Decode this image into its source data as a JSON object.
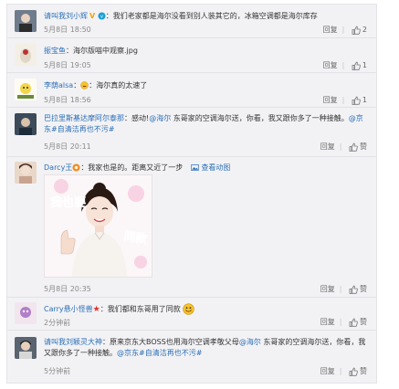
{
  "comments": [
    {
      "name": "请叫我刘小辉",
      "badge": "V",
      "text": "：我们老家都是海尔没看到别人装其它的，冰箱空调都是海尔库存",
      "date": "5月8日 18:50",
      "reply": "回复",
      "likes": "2"
    },
    {
      "name": "振宝鱼",
      "text": "：海尔版喵中观察.jpg",
      "date": "5月8日 19:05",
      "reply": "回复",
      "likes": "1"
    },
    {
      "name": "李荫alsa",
      "text": "：海尔真的太速了",
      "date": "5月8日 18:56",
      "reply": "回复",
      "likes": "1"
    },
    {
      "name": "巴拉里斯基达摩阿尔泰那",
      "text_a": "：感动!",
      "mention_a": "@海尔",
      "text_b": " 东哥家的空调海尔送，你看，我又跟你多了一种接触。",
      "mention_b": "@京东",
      "hashtag": "#自清洁再也不污#",
      "date": "5月8日 20:11",
      "reply": "回复",
      "likes": "赞"
    },
    {
      "name": "Darcy王",
      "text": "：我家也是的。距离又近了一步",
      "view_pic": "查看动图",
      "date": "5月8日 20:35",
      "reply": "回复",
      "likes": "赞"
    },
    {
      "name": "Carry悬小怪兽",
      "text": "：我们都和东哥用了同款",
      "date": "2分钟前",
      "reply": "回复",
      "likes": "赞"
    },
    {
      "name": "请叫我刘颖灵大神",
      "text_a": "：原来京东大BOSS也用海尔空调孝敬父母",
      "mention_a": "@海尔",
      "text_b": " 东哥家的空调海尔送，你看，我又跟你多了一种接触。",
      "mention_b": "@京东",
      "hashtag": "#自清洁再也不污#",
      "date": "5分钟前",
      "reply": "回复",
      "likes": "赞"
    }
  ],
  "image_text": {
    "left": "我也要",
    "right": "同款"
  },
  "colors": {
    "link": "#2b6fb6",
    "muted": "#8a8a8a",
    "panel": "#f2f2f5"
  }
}
